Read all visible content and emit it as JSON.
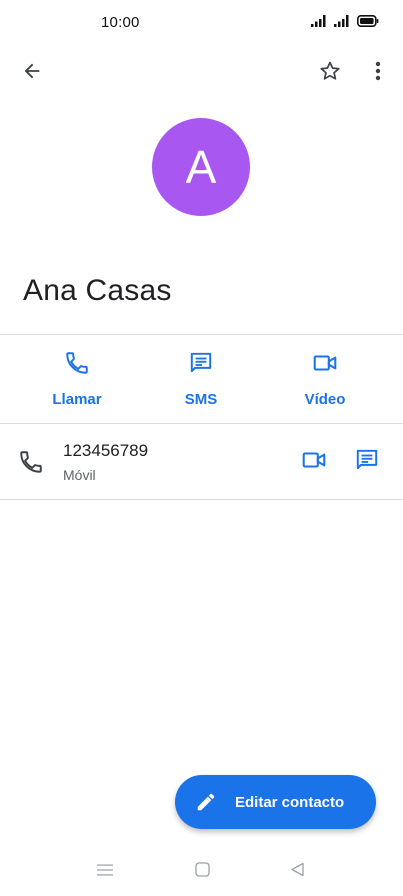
{
  "status_bar": {
    "time": "10:00",
    "icons": [
      "signal-icon",
      "signal-icon",
      "battery-icon"
    ]
  },
  "top_bar": {
    "icons": [
      "back-arrow-icon",
      "star-outline-icon",
      "more-vert-icon"
    ]
  },
  "contact": {
    "initial": "A",
    "name": "Ana Casas",
    "avatar_color": "#a857f0"
  },
  "actions": [
    {
      "label": "Llamar",
      "icon": "phone-icon"
    },
    {
      "label": "SMS",
      "icon": "message-icon"
    },
    {
      "label": "Vídeo",
      "icon": "videocam-icon"
    }
  ],
  "phone_entry": {
    "number": "123456789",
    "type": "Móvil"
  },
  "fab": {
    "label": "Editar contacto",
    "icon": "pencil-icon"
  },
  "nav_bar": {
    "icons": [
      "menu-icon",
      "home-square-icon",
      "back-triangle-icon"
    ]
  },
  "colors": {
    "accent": "#1a73e8",
    "avatar": "#a857f0",
    "divider": "#dadce0"
  }
}
